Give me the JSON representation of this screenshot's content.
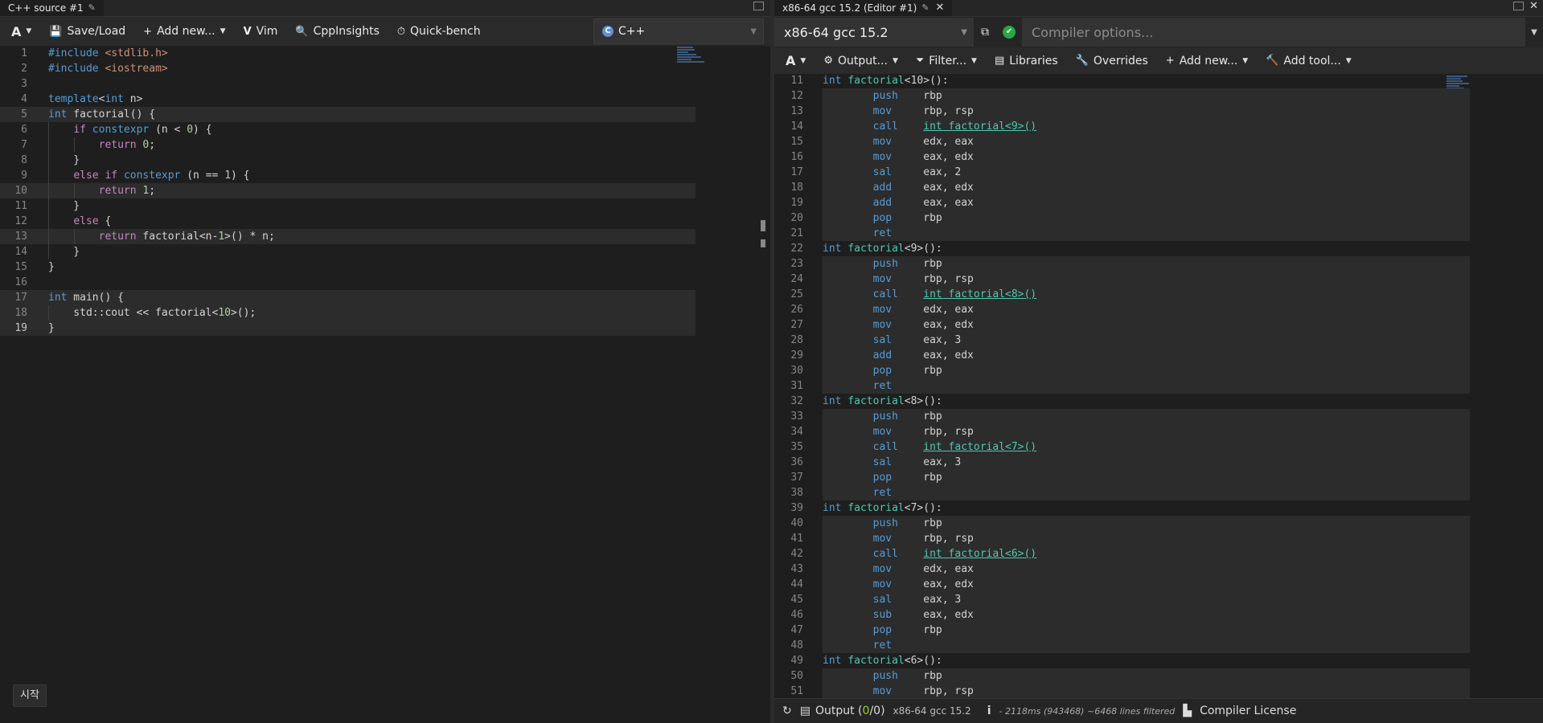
{
  "colors": {
    "accent": "#569cd6",
    "success": "#28a745",
    "label": "#4ec9b0"
  },
  "left_pane": {
    "tab_title": "C++ source #1",
    "toolbar": {
      "font_icon": "A",
      "save_load": "Save/Load",
      "add_new": "Add new...",
      "vim": "Vim",
      "cppinsights": "CppInsights",
      "quickbench": "Quick-bench"
    },
    "language": "C++",
    "start_label": "시작"
  },
  "right_pane": {
    "tab_title": "x86-64 gcc 15.2 (Editor #1)",
    "compiler_name": "x86-64 gcc 15.2",
    "options_placeholder": "Compiler options...",
    "toolbar": {
      "font_icon": "A",
      "output": "Output...",
      "filter": "Filter...",
      "libraries": "Libraries",
      "overrides": "Overrides",
      "add_new": "Add new...",
      "add_tool": "Add tool..."
    },
    "status": {
      "output_label": "Output (",
      "output_count_ok": "0",
      "output_sep": "/",
      "output_count_err": "0",
      "output_close": ")",
      "compiler": "x86-64 gcc 15.2",
      "timing": "- 2118ms (943468) ~6468 lines filtered",
      "license": "Compiler License"
    }
  },
  "source_lines": [
    "#include <stdlib.h>",
    "#include <iostream>",
    "",
    "template<int n>",
    "int factorial() {",
    "    if constexpr (n < 0) {",
    "        return 0;",
    "    }",
    "    else if constexpr (n == 1) {",
    "        return 1;",
    "    }",
    "    else {",
    "        return factorial<n-1>() * n;",
    "    }",
    "}",
    "",
    "int main() {",
    "    std::cout << factorial<10>();",
    "}"
  ],
  "asm_lines": [
    {
      "n": "11",
      "label": "int factorial<10>():"
    },
    {
      "n": "12",
      "op": "push",
      "arg": "rbp"
    },
    {
      "n": "13",
      "op": "mov",
      "arg": "rbp, rsp"
    },
    {
      "n": "14",
      "op": "call",
      "link": "int factorial<9>()"
    },
    {
      "n": "15",
      "op": "mov",
      "arg": "edx, eax"
    },
    {
      "n": "16",
      "op": "mov",
      "arg": "eax, edx"
    },
    {
      "n": "17",
      "op": "sal",
      "arg": "eax, 2"
    },
    {
      "n": "18",
      "op": "add",
      "arg": "eax, edx"
    },
    {
      "n": "19",
      "op": "add",
      "arg": "eax, eax"
    },
    {
      "n": "20",
      "op": "pop",
      "arg": "rbp"
    },
    {
      "n": "21",
      "op": "ret",
      "arg": ""
    },
    {
      "n": "22",
      "label": "int factorial<9>():"
    },
    {
      "n": "23",
      "op": "push",
      "arg": "rbp"
    },
    {
      "n": "24",
      "op": "mov",
      "arg": "rbp, rsp"
    },
    {
      "n": "25",
      "op": "call",
      "link": "int factorial<8>()"
    },
    {
      "n": "26",
      "op": "mov",
      "arg": "edx, eax"
    },
    {
      "n": "27",
      "op": "mov",
      "arg": "eax, edx"
    },
    {
      "n": "28",
      "op": "sal",
      "arg": "eax, 3"
    },
    {
      "n": "29",
      "op": "add",
      "arg": "eax, edx"
    },
    {
      "n": "30",
      "op": "pop",
      "arg": "rbp"
    },
    {
      "n": "31",
      "op": "ret",
      "arg": ""
    },
    {
      "n": "32",
      "label": "int factorial<8>():"
    },
    {
      "n": "33",
      "op": "push",
      "arg": "rbp"
    },
    {
      "n": "34",
      "op": "mov",
      "arg": "rbp, rsp"
    },
    {
      "n": "35",
      "op": "call",
      "link": "int factorial<7>()"
    },
    {
      "n": "36",
      "op": "sal",
      "arg": "eax, 3"
    },
    {
      "n": "37",
      "op": "pop",
      "arg": "rbp"
    },
    {
      "n": "38",
      "op": "ret",
      "arg": ""
    },
    {
      "n": "39",
      "label": "int factorial<7>():"
    },
    {
      "n": "40",
      "op": "push",
      "arg": "rbp"
    },
    {
      "n": "41",
      "op": "mov",
      "arg": "rbp, rsp"
    },
    {
      "n": "42",
      "op": "call",
      "link": "int factorial<6>()"
    },
    {
      "n": "43",
      "op": "mov",
      "arg": "edx, eax"
    },
    {
      "n": "44",
      "op": "mov",
      "arg": "eax, edx"
    },
    {
      "n": "45",
      "op": "sal",
      "arg": "eax, 3"
    },
    {
      "n": "46",
      "op": "sub",
      "arg": "eax, edx"
    },
    {
      "n": "47",
      "op": "pop",
      "arg": "rbp"
    },
    {
      "n": "48",
      "op": "ret",
      "arg": ""
    },
    {
      "n": "49",
      "label": "int factorial<6>():"
    },
    {
      "n": "50",
      "op": "push",
      "arg": "rbp"
    },
    {
      "n": "51",
      "op": "mov",
      "arg": "rbp, rsp"
    }
  ]
}
